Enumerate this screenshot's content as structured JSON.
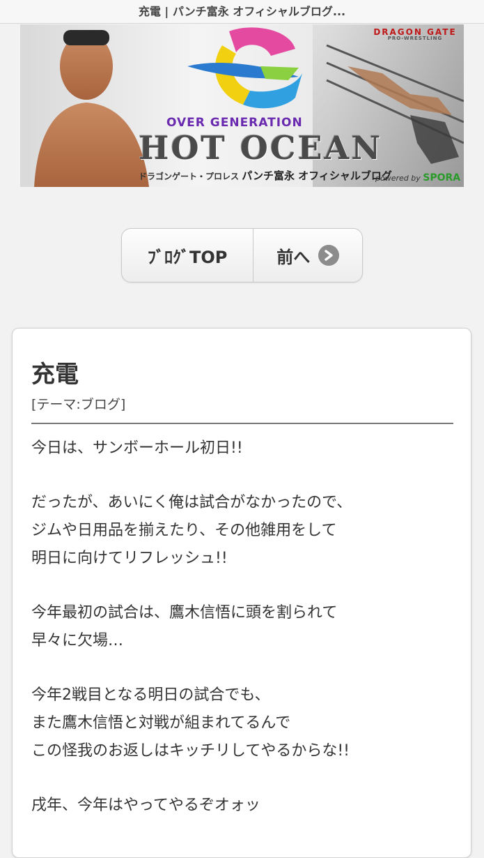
{
  "page": {
    "title": "充電 | パンチ富永 オフィシャルブログ..."
  },
  "banner": {
    "logo_subtitle": "OVER GENERATION",
    "logo_title": "HOT OCEAN",
    "promotion_logo": "DRAGON GATE",
    "promotion_logo_sub": "PRO-WRESTLING",
    "tagline_prefix": "ドラゴンゲート・プロレス",
    "tagline_main": "パンチ富永 オフィシャルブログ",
    "powered_by": "powered by",
    "powered_brand": "SPORA"
  },
  "nav": {
    "top_label": "ﾌﾞﾛｸﾞTOP",
    "prev_label": "前へ",
    "prev_icon": "chevron-right-icon"
  },
  "post": {
    "title": "充電",
    "theme": "[テーマ:ブログ]",
    "paragraphs": [
      [
        "今日は、サンボーホール初日!!"
      ],
      [
        "だったが、あいにく俺は試合がなかったので、",
        "ジムや日用品を揃えたり、その他雑用をして",
        "明日に向けてリフレッシュ!!"
      ],
      [
        "今年最初の試合は、鷹木信悟に頭を割られて",
        "早々に欠場…"
      ],
      [
        "今年2戦目となる明日の試合でも、",
        "また鷹木信悟と対戦が組まれてるんで",
        "この怪我のお返しはキッチリしてやるからな!!"
      ],
      [
        "戌年、今年はやってやるぞオォッ"
      ]
    ]
  },
  "colors": {
    "background": "#f2f2f2",
    "card": "#ffffff",
    "text": "#333333",
    "arrow": "#8c8c8c"
  }
}
